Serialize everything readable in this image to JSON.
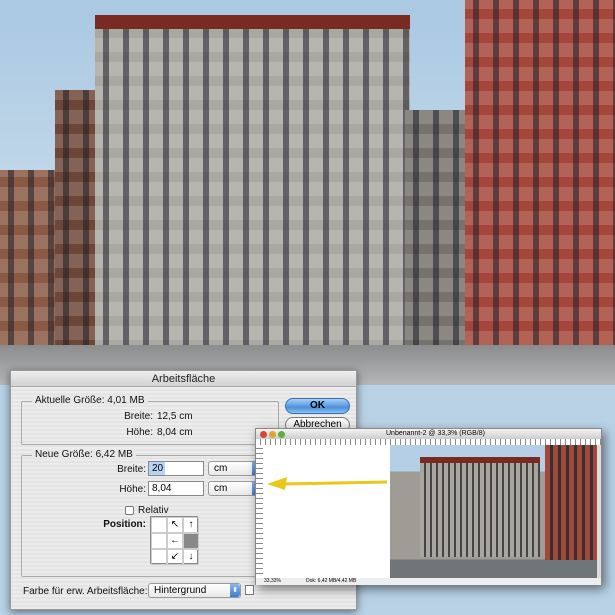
{
  "dialog": {
    "title": "Arbeitsfläche",
    "current_size": "Aktuelle Größe: 4,01 MB",
    "current_width_label": "Breite:",
    "current_width": "12,5 cm",
    "current_height_label": "Höhe:",
    "current_height": "8,04 cm",
    "new_size": "Neue Größe: 6,42 MB",
    "width_label": "Breite:",
    "width_value": "20",
    "width_unit": "cm",
    "height_label": "Höhe:",
    "height_value": "8,04",
    "height_unit": "cm",
    "relative_label": "Relativ",
    "position_label": "Position:",
    "ok_label": "OK",
    "cancel_label": "Abbrechen",
    "extension_color_label": "Farbe für erw. Arbeitsfläche:",
    "extension_color_value": "Hintergrund"
  },
  "document": {
    "title": "Unbenannt-2 @ 33,3% (RGB/8)",
    "zoom": "33,33%",
    "doc_info": "Dok: 6,42 MB/4,42 MB"
  },
  "colors": {
    "ok_button": "#4b8fdc",
    "arrow": "#e8c81a"
  }
}
